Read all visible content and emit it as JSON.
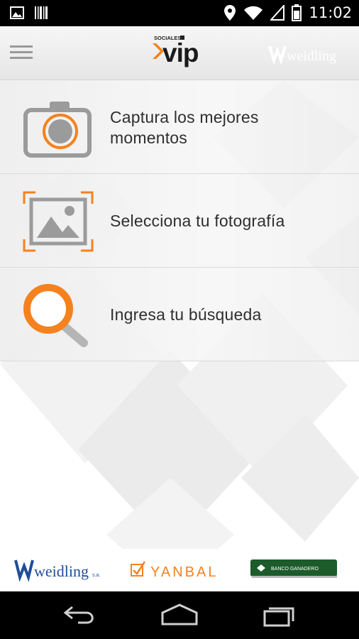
{
  "status_bar": {
    "time": "11:02",
    "icons": [
      "image-icon",
      "barcode-icon",
      "location-icon",
      "wifi-icon",
      "signal-icon",
      "battery-icon"
    ]
  },
  "app_bar": {
    "menu_icon": "hamburger-icon",
    "logo_small": "SOCIALES",
    "logo_main": "vip",
    "partner_logo": "weidling"
  },
  "menu": [
    {
      "icon": "camera-icon",
      "label_line1": "Captura los mejores",
      "label_line2": "momentos"
    },
    {
      "icon": "image-frame-icon",
      "label": "Selecciona tu fotografía"
    },
    {
      "icon": "search-icon",
      "label": "Ingresa tu búsqueda"
    }
  ],
  "sponsors": {
    "weidling": "weidling",
    "weidling_suffix": "s.a.",
    "yanbal": "YANBAL",
    "banco": "BANCO GANADERO"
  },
  "colors": {
    "accent": "#f5821f",
    "icon_gray": "#9b9b9b",
    "text": "#2f2f2f",
    "banco_green": "#1c5b2a",
    "weidling_blue": "#1f4e99"
  },
  "nav_bar": [
    "back-icon",
    "home-icon",
    "recents-icon"
  ]
}
